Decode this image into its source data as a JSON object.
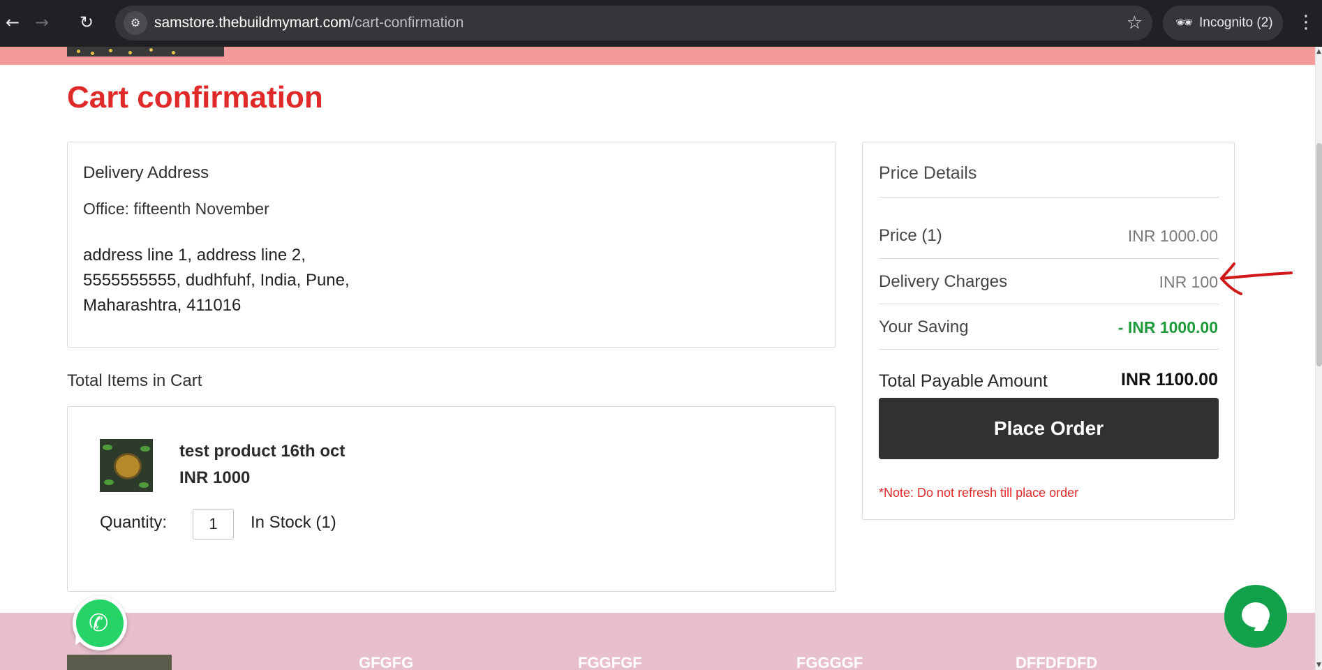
{
  "browser": {
    "url_host": "samstore.thebuildmymart.com",
    "url_path": "/cart-confirmation",
    "incognito_label": "Incognito (2)"
  },
  "page": {
    "title": "Cart confirmation",
    "address": {
      "heading": "Delivery Address",
      "office": "Office: fifteenth November",
      "line1": "address line 1, address line 2,",
      "line2": "5555555555, dudhfuhf, India, Pune,",
      "line3": "Maharashtra, 411016"
    },
    "items_heading": "Total Items in Cart",
    "item": {
      "name": "test product 16th oct",
      "price": "INR 1000",
      "quantity_label": "Quantity:",
      "quantity_value": "1",
      "stock": "In Stock (1)"
    },
    "price_details": {
      "heading": "Price Details",
      "price_label": "Price  (1)",
      "price_value": "INR 1000.00",
      "delivery_label": "Delivery Charges",
      "delivery_value": "INR 100",
      "saving_label": "Your Saving",
      "saving_value": "- INR 1000.00",
      "total_label": "Total Payable Amount",
      "total_value": "INR  1100.00",
      "place_order": "Place Order",
      "note": "*Note: Do not refresh till place order"
    },
    "footer": {
      "col1": "GFGFG",
      "col2": "FGGFGF",
      "col3": "FGGGGF",
      "col4": "DFFDFDFD"
    }
  },
  "colors": {
    "accent_red": "#e02a2a",
    "saving_green": "#1e9a3a",
    "top_band": "#f49a9a",
    "footer_band": "#e8bfcc",
    "button_dark": "#313131"
  },
  "icons": [
    "back-icon",
    "forward-icon",
    "reload-icon",
    "site-info-icon",
    "star-icon",
    "incognito-icon",
    "menu-icon",
    "whatsapp-icon",
    "chat-icon"
  ]
}
